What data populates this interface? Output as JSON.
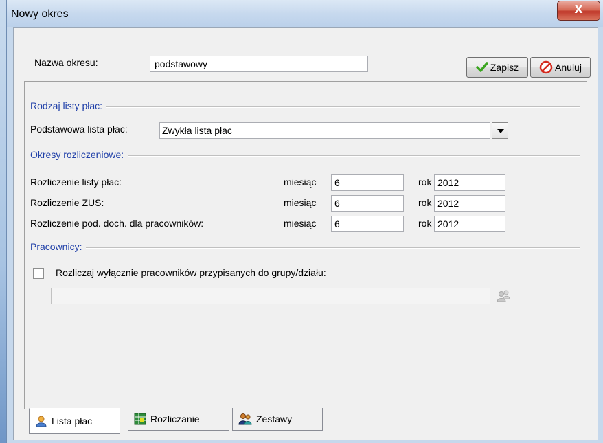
{
  "window": {
    "title": "Nowy okres",
    "close_glyph": "X"
  },
  "form": {
    "name_label": "Nazwa okresu:",
    "name_value": "podstawowy",
    "save_label": "Zapisz",
    "cancel_label": "Anuluj"
  },
  "payroll_type": {
    "section_title": "Rodzaj listy płac:",
    "base_label": "Podstawowa lista płac:",
    "base_value": "Zwykła lista płac"
  },
  "periods": {
    "section_title": "Okresy rozliczeniowe:",
    "month_label": "miesiąc",
    "year_label": "rok",
    "rows": [
      {
        "label": "Rozliczenie listy płac:",
        "month": "6",
        "year": "2012"
      },
      {
        "label": "Rozliczenie ZUS:",
        "month": "6",
        "year": "2012"
      },
      {
        "label": "Rozliczenie pod. doch. dla pracowników:",
        "month": "6",
        "year": "2012"
      }
    ]
  },
  "employees": {
    "section_title": "Pracownicy:",
    "restrict_label": "Rozliczaj wyłącznie pracowników przypisanych do grupy/działu:",
    "restrict_checked": false,
    "group_value": ""
  },
  "tabs": [
    {
      "label": "Lista płac",
      "icon": "user-icon",
      "active": true
    },
    {
      "label": "Rozliczanie",
      "icon": "spreadsheet-icon",
      "active": false
    },
    {
      "label": "Zestawy",
      "icon": "people-icon",
      "active": false
    }
  ],
  "colors": {
    "section_title": "#1f3fa8",
    "close_button": "#c0392b",
    "save_check": "#3aa51f",
    "cancel_icon": "#d42a1e"
  }
}
